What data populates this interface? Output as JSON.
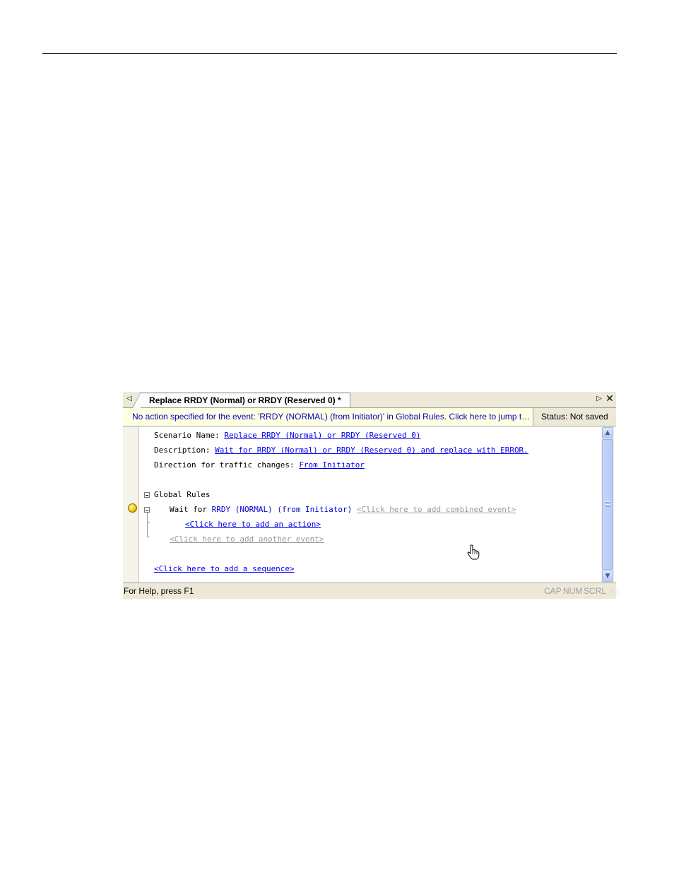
{
  "tab": {
    "title": "Replace RRDY (Normal) or RRDY (Reserved 0) *"
  },
  "message": {
    "text": "No action specified for the event: 'RRDY (NORMAL) (from Initiator)' in Global Rules.  Click here to jump to the p...",
    "status": "Status: Not saved"
  },
  "editor": {
    "scenario_label": "Scenario Name: ",
    "scenario_value": "Replace RRDY (Normal) or RRDY (Reserved 0)",
    "description_label": "Description: ",
    "description_value": "Wait for RRDY (Normal) or RRDY (Reserved 0) and replace with ERROR.",
    "direction_label": "Direction for traffic changes: ",
    "direction_value": "From Initiator",
    "global_rules": "Global Rules",
    "wait_for": "Wait for ",
    "event_name": "RRDY (NORMAL) (from Initiator)",
    "add_combined_event": "<Click here to add combined event>",
    "add_action": "<Click here to add an action>",
    "add_another_event": "<Click here to add another event>",
    "add_sequence": "<Click here to add a sequence>"
  },
  "statusbar": {
    "help": "For Help, press F1",
    "cap": "CAP",
    "num": "NUM",
    "scrl": "SCRL"
  },
  "icons": {
    "breakpoint": "warning-dot-icon",
    "cursor": "hand-pointer-icon"
  }
}
